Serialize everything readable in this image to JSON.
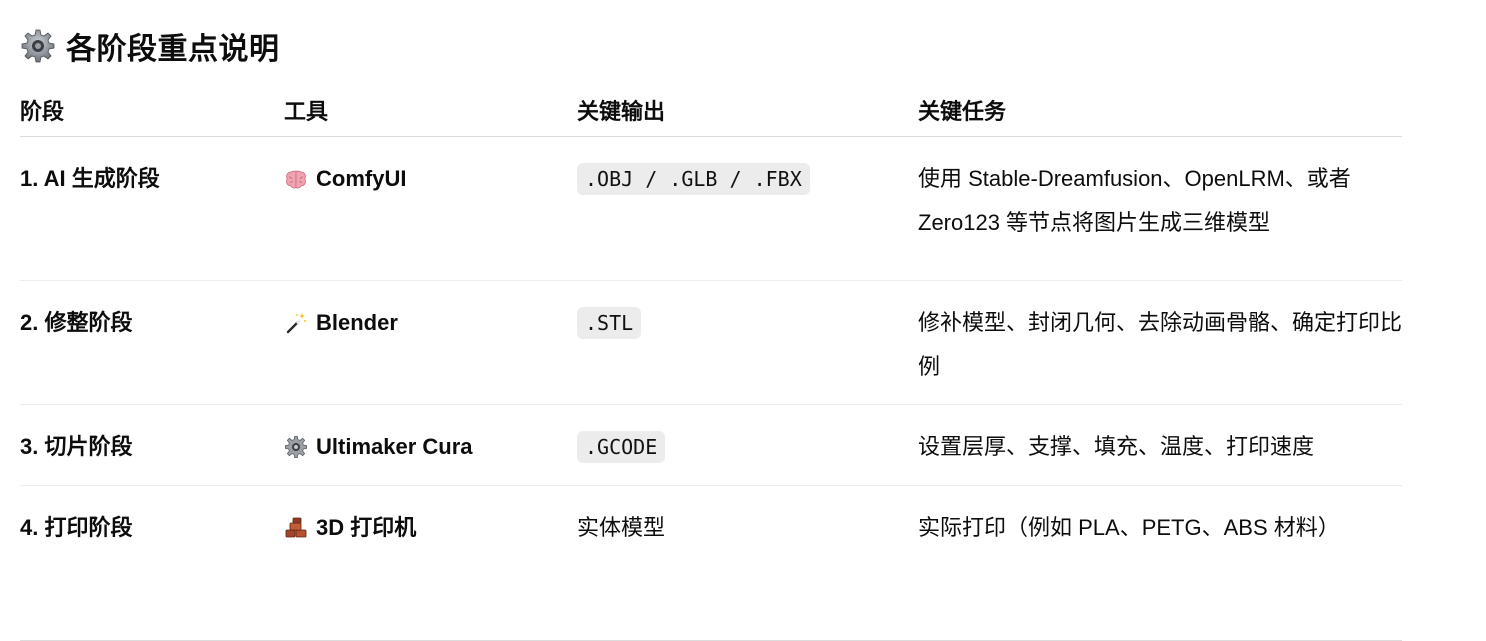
{
  "heading": {
    "icon": "gear-icon",
    "title": "各阶段重点说明"
  },
  "table": {
    "headers": [
      "阶段",
      "工具",
      "关键输出",
      "关键任务"
    ],
    "rows": [
      {
        "stage": "1. AI 生成阶段",
        "tool_icon": "brain-icon",
        "tool": "ComfyUI",
        "output": ".OBJ / .GLB / .FBX",
        "output_is_code": true,
        "task": "使用 Stable-Dreamfusion、OpenLRM、或者 Zero123 等节点将图片生成三维模型"
      },
      {
        "stage": "2. 修整阶段",
        "tool_icon": "magic-wand-icon",
        "tool": "Blender",
        "output": ".STL",
        "output_is_code": true,
        "task": "修补模型、封闭几何、去除动画骨骼、确定打印比例"
      },
      {
        "stage": "3. 切片阶段",
        "tool_icon": "gear-icon",
        "tool": "Ultimaker Cura",
        "output": ".GCODE",
        "output_is_code": true,
        "task": "设置层厚、支撑、填充、温度、打印速度"
      },
      {
        "stage": "4. 打印阶段",
        "tool_icon": "bricks-icon",
        "tool": "3D 打印机",
        "output": "实体模型",
        "output_is_code": false,
        "task": "实际打印（例如 PLA、PETG、ABS 材料）"
      }
    ]
  },
  "colors": {
    "text": "#0d0d0d",
    "code_background": "#ececec",
    "row_divider": "#ececec"
  }
}
